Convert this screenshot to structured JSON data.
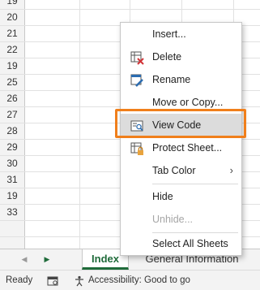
{
  "grid": {
    "row_numbers": [
      "19",
      "20",
      "21",
      "22",
      "19",
      "25",
      "26",
      "27",
      "28",
      "29",
      "30",
      "31",
      "19",
      "33"
    ]
  },
  "context_menu": {
    "items": [
      {
        "label": "Insert...",
        "icon": "none"
      },
      {
        "label": "Delete",
        "icon": "delete-sheet-icon"
      },
      {
        "label": "Rename",
        "icon": "rename-sheet-icon"
      },
      {
        "label": "Move or Copy...",
        "icon": "none"
      },
      {
        "label": "View Code",
        "icon": "view-code-icon",
        "highlighted": true
      },
      {
        "label": "Protect Sheet...",
        "icon": "protect-sheet-icon"
      },
      {
        "label": "Tab Color",
        "icon": "none",
        "submenu": true
      },
      {
        "label": "Hide",
        "icon": "none"
      },
      {
        "label": "Unhide...",
        "icon": "none",
        "disabled": true
      },
      {
        "label": "Select All Sheets",
        "icon": "none"
      }
    ]
  },
  "tabs": {
    "items": [
      {
        "label": "Index",
        "selected": true
      },
      {
        "label": "General Information",
        "selected": false
      }
    ]
  },
  "status": {
    "ready": "Ready",
    "accessibility": "Accessibility: Good to go"
  },
  "colors": {
    "accent_green": "#1f6b3a",
    "highlight_orange": "#f07f1b"
  }
}
